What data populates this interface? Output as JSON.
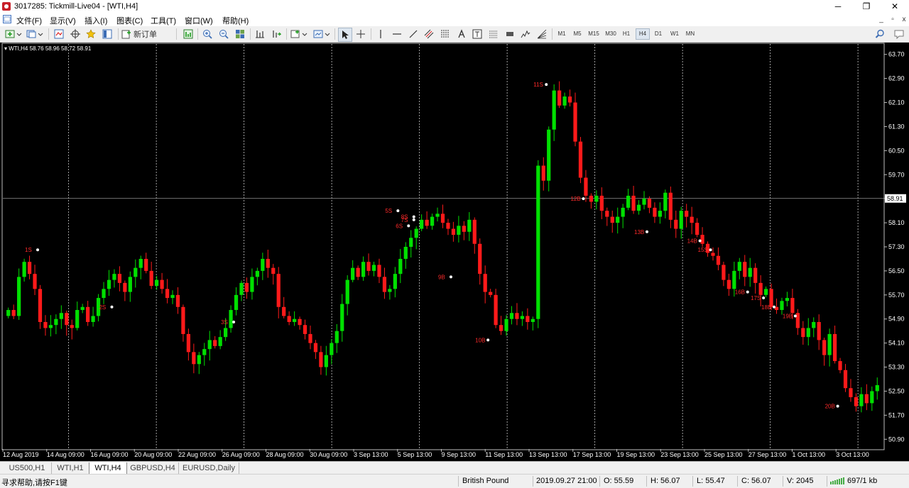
{
  "window": {
    "title": "3017285: Tickmill-Live04 - [WTI,H4]",
    "controls": {
      "minimize": "─",
      "restore": "❐",
      "close": "✕"
    }
  },
  "menu": {
    "items": [
      "文件(F)",
      "显示(V)",
      "插入(I)",
      "图表(C)",
      "工具(T)",
      "窗口(W)",
      "帮助(H)"
    ],
    "mdi": {
      "minimize": "_",
      "restore": "▫",
      "close": "x"
    }
  },
  "toolbar": {
    "new_order_label": "新订单",
    "timeframes": [
      "M1",
      "M5",
      "M15",
      "M30",
      "H1",
      "H4",
      "D1",
      "W1",
      "MN"
    ],
    "active_timeframe": "H4"
  },
  "chart": {
    "info_label": "▾ WTI,H4  58.76 58.96 58.72 58.91",
    "symbol": "WTI",
    "period": "H4",
    "ohlc": {
      "open": 58.76,
      "high": 58.96,
      "low": 58.72,
      "close": 58.91
    },
    "current_price_label": "58.91",
    "colors": {
      "background": "#000000",
      "bull": "#00e000",
      "bear": "#ff1a1a",
      "price_line": "#9a9a9a",
      "text": "#ffffff",
      "marker_text": "#ff2a2a"
    }
  },
  "chart_data": {
    "type": "candlestick",
    "title": "WTI,H4",
    "y_ticks": [
      "63.70",
      "62.90",
      "62.10",
      "61.30",
      "60.50",
      "59.70",
      "58.91",
      "58.10",
      "57.30",
      "56.50",
      "55.70",
      "54.90",
      "54.10",
      "53.30",
      "52.50",
      "51.70",
      "50.90"
    ],
    "x_ticks": [
      "12 Aug 2019",
      "14 Aug 09:00",
      "16 Aug 09:00",
      "20 Aug 09:00",
      "22 Aug 09:00",
      "26 Aug 09:00",
      "28 Aug 09:00",
      "30 Aug 09:00",
      "3 Sep 13:00",
      "5 Sep 13:00",
      "9 Sep 13:00",
      "11 Sep 13:00",
      "13 Sep 13:00",
      "17 Sep 13:00",
      "19 Sep 13:00",
      "23 Sep 13:00",
      "25 Sep 13:00",
      "27 Sep 13:00",
      "1 Oct 13:00",
      "3 Oct 13:00"
    ],
    "ylim": [
      50.6,
      64.0
    ],
    "closes": [
      55.2,
      55.0,
      56.3,
      56.8,
      56.4,
      55.9,
      54.8,
      54.6,
      54.7,
      54.9,
      55.1,
      54.7,
      54.6,
      55.2,
      55.3,
      54.8,
      55.0,
      55.6,
      55.9,
      56.2,
      56.4,
      56.1,
      55.8,
      56.3,
      56.6,
      56.9,
      56.5,
      56.0,
      56.2,
      55.9,
      55.6,
      55.7,
      55.3,
      54.4,
      53.8,
      53.4,
      53.7,
      53.9,
      54.2,
      54.0,
      54.3,
      54.6,
      55.2,
      55.7,
      56.1,
      55.8,
      56.3,
      56.5,
      56.9,
      56.6,
      56.4,
      55.3,
      55.0,
      54.8,
      54.9,
      54.7,
      54.4,
      54.1,
      53.8,
      53.3,
      53.7,
      54.1,
      54.5,
      55.4,
      56.2,
      56.6,
      56.3,
      56.8,
      56.5,
      56.7,
      56.3,
      55.8,
      55.9,
      56.4,
      56.9,
      57.3,
      57.6,
      57.9,
      58.2,
      58.0,
      58.3,
      58.4,
      58.1,
      57.9,
      57.7,
      58.0,
      57.8,
      58.2,
      57.4,
      56.4,
      55.8,
      55.7,
      54.7,
      54.5,
      54.9,
      55.1,
      54.9,
      55.0,
      54.8,
      54.9,
      60.0,
      59.5,
      61.2,
      62.5,
      62.0,
      62.3,
      62.1,
      60.8,
      59.6,
      59.0,
      58.8,
      59.0,
      58.5,
      58.3,
      58.1,
      58.3,
      58.6,
      59.0,
      58.5,
      58.7,
      58.9,
      58.6,
      58.3,
      58.5,
      59.1,
      58.2,
      57.9,
      58.5,
      58.3,
      58.1,
      57.7,
      57.4,
      57.1,
      57.0,
      56.7,
      56.2,
      55.9,
      56.5,
      56.8,
      56.3,
      56.6,
      56.1,
      55.7,
      55.9,
      55.3,
      55.2,
      55.5,
      55.6,
      55.1,
      54.6,
      54.3,
      54.6,
      54.8,
      54.2,
      53.7,
      54.4,
      53.5,
      53.2,
      52.6,
      52.3,
      52.0,
      52.4,
      52.1,
      52.5,
      52.7
    ],
    "signals": [
      {
        "label": "1S",
        "price": 57.2
      },
      {
        "label": "2S",
        "price": 55.3
      },
      {
        "label": "3S",
        "price": 54.8
      },
      {
        "label": "5S",
        "price": 58.5
      },
      {
        "label": "6S",
        "price": 58.0
      },
      {
        "label": "7S",
        "price": 58.2
      },
      {
        "label": "8S",
        "price": 58.3
      },
      {
        "label": "9B",
        "price": 56.3
      },
      {
        "label": "10B",
        "price": 54.2
      },
      {
        "label": "11S",
        "price": 62.7
      },
      {
        "label": "12B",
        "price": 58.9
      },
      {
        "label": "13B",
        "price": 57.8
      },
      {
        "label": "14B",
        "price": 57.5
      },
      {
        "label": "15S",
        "price": 57.2
      },
      {
        "label": "16B",
        "price": 55.8
      },
      {
        "label": "17S",
        "price": 55.6
      },
      {
        "label": "18B",
        "price": 55.3
      },
      {
        "label": "19B",
        "price": 55.0
      },
      {
        "label": "20B",
        "price": 52.0
      }
    ]
  },
  "tabs": [
    {
      "label": "US500,H1",
      "active": false
    },
    {
      "label": "WTI,H1",
      "active": false
    },
    {
      "label": "WTI,H4",
      "active": true
    },
    {
      "label": "GBPUSD,H4",
      "active": false
    },
    {
      "label": "EURUSD,Daily",
      "active": false
    }
  ],
  "status": {
    "help": "寻求帮助,请按F1键",
    "profile": "British Pound",
    "datetime": "2019.09.27 21:00",
    "open": "O: 55.59",
    "high": "H: 56.07",
    "low": "L: 55.47",
    "close": "C: 56.07",
    "volume": "V: 2045",
    "traffic": "697/1 kb"
  }
}
